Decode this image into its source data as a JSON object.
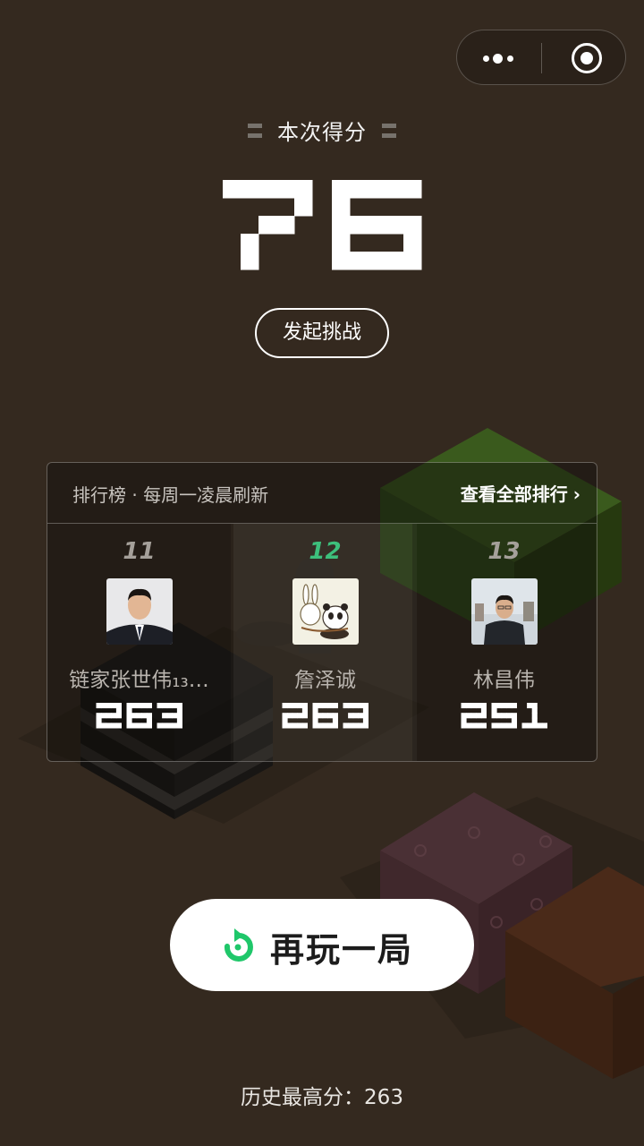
{
  "capsule": {
    "more_icon": "more-dots-icon",
    "close_icon": "target-circle-icon"
  },
  "score": {
    "title": "本次得分",
    "value": "76"
  },
  "challenge": {
    "label": "发起挑战"
  },
  "leaderboard": {
    "title": "排行榜 · 每周一凌晨刷新",
    "view_all": "查看全部排行",
    "entries": [
      {
        "rank": "11",
        "name": "链家张世伟₁₃…",
        "score": "263",
        "is_me": false
      },
      {
        "rank": "12",
        "name": "詹泽诚",
        "score": "263",
        "is_me": true
      },
      {
        "rank": "13",
        "name": "林昌伟",
        "score": "251",
        "is_me": false
      }
    ]
  },
  "replay": {
    "label": "再玩一局",
    "icon": "replay-icon"
  },
  "best": {
    "text": "历史最高分：263"
  },
  "colors": {
    "background": "#34291f",
    "accent_green": "#1fc76a",
    "rank_highlight": "#3dbf7c"
  }
}
